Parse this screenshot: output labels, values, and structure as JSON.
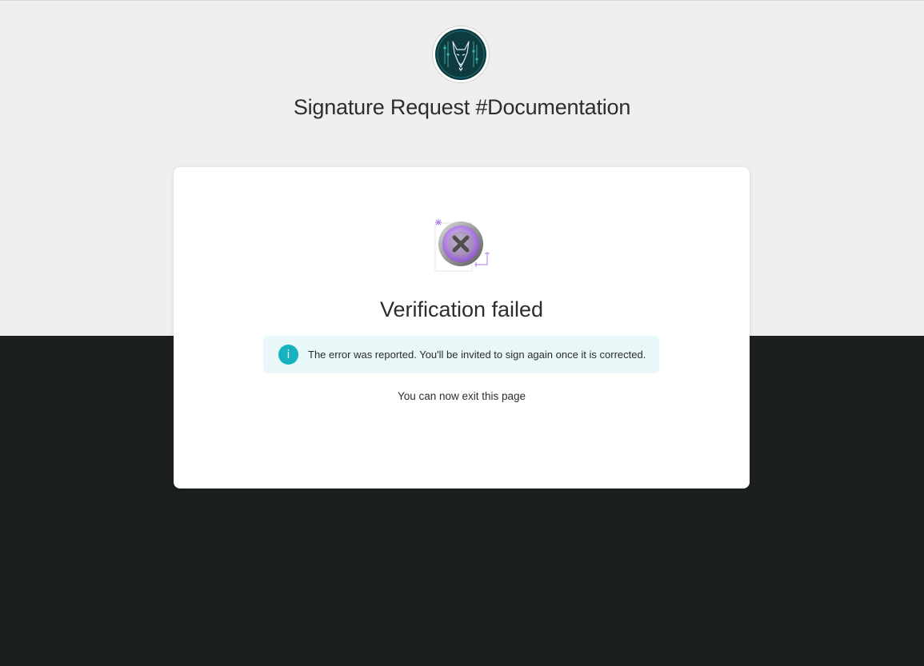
{
  "header": {
    "logo_icon": "fox-emblem-icon",
    "title": "Signature Request #Documentation"
  },
  "result": {
    "status_icon": "verification-failed-x-icon",
    "heading": "Verification failed",
    "info": {
      "icon": "info-icon",
      "icon_glyph": "i",
      "message": "The error was reported. You'll be invited to sign again once it is corrected."
    },
    "exit_message": "You can now exit this page"
  },
  "colors": {
    "top_background": "#efefef",
    "bottom_background": "#1b1f1f",
    "card_background": "#ffffff",
    "info_background": "#e8f7f8",
    "info_accent": "#16b2bf",
    "logo_background": "#0e3b40",
    "illustration_accent": "#b07ee0"
  }
}
